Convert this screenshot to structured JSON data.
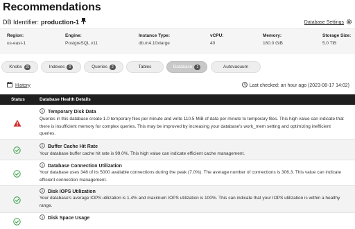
{
  "page": {
    "title": "Recommendations",
    "db_identifier_label": "DB Identifier:",
    "db_identifier_value": "production-1",
    "db_settings_label": "Database Settings"
  },
  "info": [
    {
      "key": "Region:",
      "value": "us-east-1"
    },
    {
      "key": "Engine:",
      "value": "PostgreSQL v11"
    },
    {
      "key": "Instance Type:",
      "value": "db.m4.10xlarge"
    },
    {
      "key": "vCPU:",
      "value": "40"
    },
    {
      "key": "Memory:",
      "value": "160.0 GiB"
    },
    {
      "key": "Storage Size:",
      "value": "5.0 TiB"
    }
  ],
  "tabs": [
    {
      "label": "Knobs",
      "badge": "15",
      "active": false
    },
    {
      "label": "Indexes",
      "badge": "0",
      "active": false
    },
    {
      "label": "Queries",
      "badge": "2",
      "active": false
    },
    {
      "label": "Tables",
      "badge": "",
      "active": false
    },
    {
      "label": "Database",
      "badge": "1",
      "active": true
    },
    {
      "label": "Autovacuum",
      "badge": "",
      "active": false
    }
  ],
  "history_label": "History",
  "last_checked": "Last checked: an hour ago (2023-08-17 14:02)",
  "table": {
    "col_status": "Status",
    "col_details": "Database Health Details",
    "rows": [
      {
        "status": "warning",
        "title": "Temporary Disk Data",
        "description": "Queries in this database create 1.0 temporary files per minute and write 110.5 MiB of data per minute to temporary files. This high value can indicate that there is insufficient memory for complex queries. This may be improved by increasing your database's work_mem setting and optimizing inefficient queries."
      },
      {
        "status": "ok",
        "title": "Buffer Cache Hit Rate",
        "description": "Your database buffer cache hit rate is 99.0%. This high value can indicate efficient cache management."
      },
      {
        "status": "ok",
        "title": "Database Connection Utilization",
        "description": "Your database uses 348 of its 5000 available connections during the peak (7.0%). The average number of connections is 306.3. This value can indicate efficient connection management."
      },
      {
        "status": "ok",
        "title": "Disk IOPS Utilization",
        "description": "Your database's average IOPS utilization is 1.4% and maximum IOPS utilization is 100%. This can indicate that your IOPS utilization is within a healthy range."
      },
      {
        "status": "ok",
        "title": "Disk Space Usage",
        "description": ""
      }
    ]
  },
  "colors": {
    "warning": "#d32f2f",
    "ok": "#2e9e3e",
    "header_bg": "#1f1f1f"
  }
}
